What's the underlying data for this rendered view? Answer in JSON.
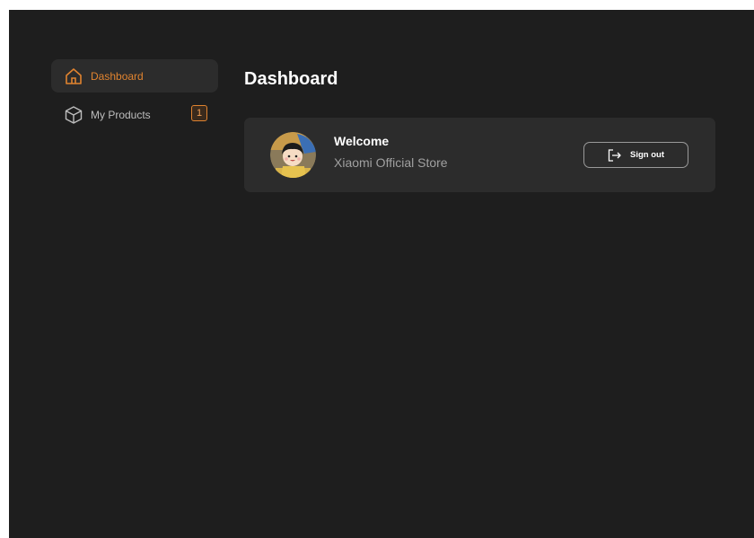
{
  "sidebar": {
    "items": [
      {
        "label": "Dashboard",
        "icon": "home-icon",
        "active": true
      },
      {
        "label": "My Products",
        "icon": "box-icon",
        "active": false,
        "badge": "1"
      }
    ]
  },
  "main": {
    "title": "Dashboard",
    "welcome_card": {
      "title": "Welcome",
      "store_name": "Xiaomi Official Store",
      "avatar": "avatar",
      "signout_label": "Sign out",
      "signout_icon": "sign-out-icon"
    }
  },
  "colors": {
    "background": "#1e1e1e",
    "card": "#2c2c2c",
    "accent": "#e0832f",
    "text": "#ffffff",
    "muted_text": "#a0a0a0"
  }
}
